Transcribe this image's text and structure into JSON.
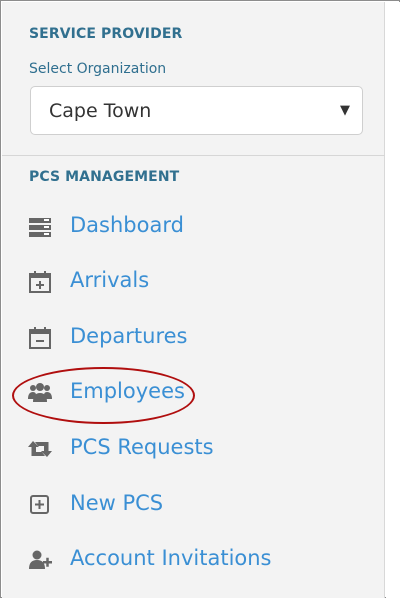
{
  "service_provider": {
    "title": "SERVICE PROVIDER",
    "select_label": "Select Organization",
    "selected_value": "Cape Town",
    "dropdown_arrow": "▼"
  },
  "pcs_management": {
    "title": "PCS MANAGEMENT",
    "items": [
      {
        "label": "Dashboard",
        "icon": "dashboard-icon"
      },
      {
        "label": "Arrivals",
        "icon": "calendar-plus-icon"
      },
      {
        "label": "Departures",
        "icon": "calendar-minus-icon"
      },
      {
        "label": "Employees",
        "icon": "users-icon"
      },
      {
        "label": "PCS Requests",
        "icon": "retweet-icon"
      },
      {
        "label": "New PCS",
        "icon": "plus-square-icon"
      },
      {
        "label": "Account Invitations",
        "icon": "user-plus-icon"
      }
    ]
  },
  "colors": {
    "section_title": "#31708f",
    "link": "#3a8fd4",
    "icon": "#666666",
    "highlight_ring": "#b00e0e"
  }
}
